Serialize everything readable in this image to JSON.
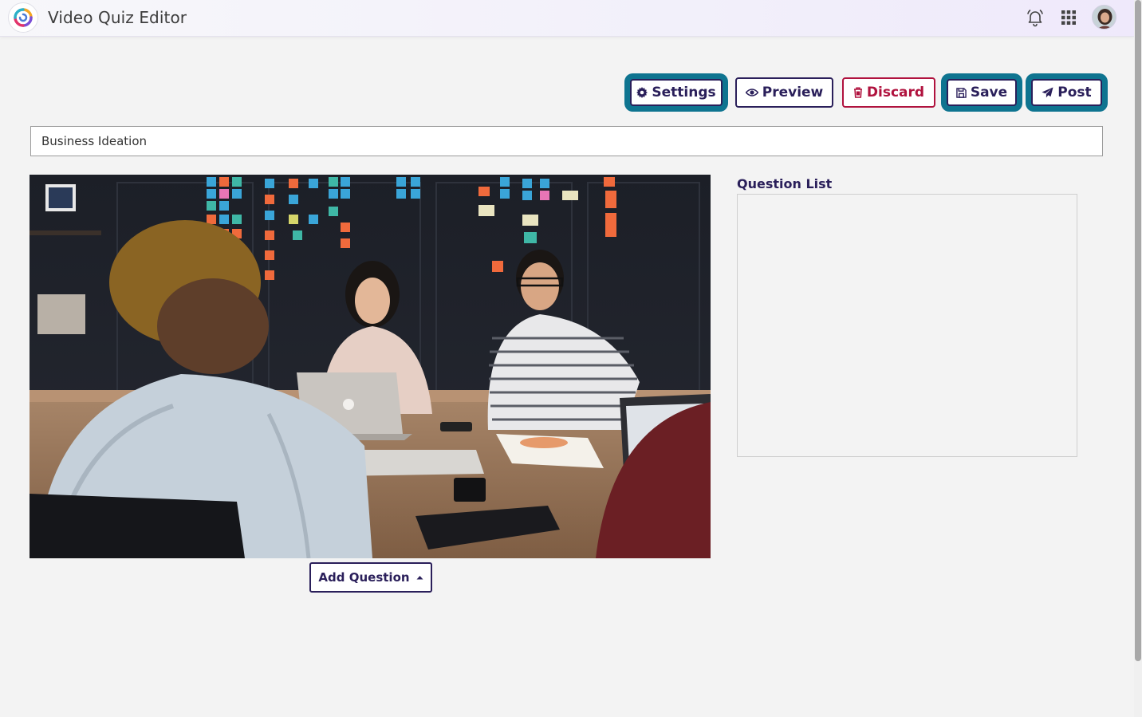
{
  "header": {
    "app_title": "Video Quiz Editor",
    "logo_icon": "app-logo-swirl",
    "notification_icon": "bell-icon",
    "apps_icon": "grid-icon",
    "avatar_icon": "user-avatar"
  },
  "toolbar": {
    "settings_label": "Settings",
    "preview_label": "Preview",
    "discard_label": "Discard",
    "save_label": "Save",
    "post_label": "Post"
  },
  "quiz": {
    "title_value": "Business Ideation"
  },
  "video": {
    "description_icon": "video-frame"
  },
  "add_question": {
    "label": "Add Question"
  },
  "question_list": {
    "heading": "Question List",
    "items": []
  },
  "colors": {
    "primary": "#2a1f5a",
    "focus_ring": "#0e7490",
    "danger": "#b0123e",
    "background": "#f3f3f3"
  }
}
